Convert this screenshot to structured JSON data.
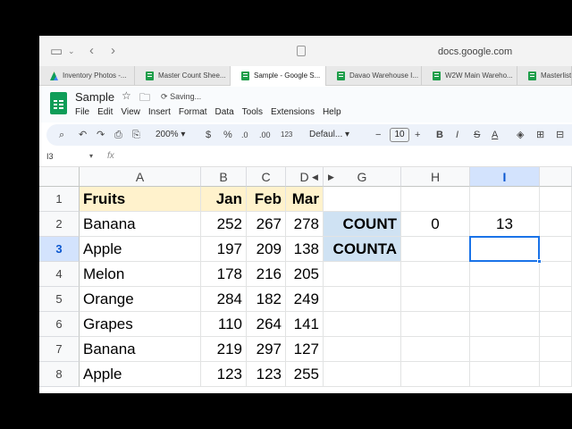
{
  "browser": {
    "url": "docs.google.com",
    "tabs": [
      {
        "label": "Inventory Photos -...",
        "icon": "drive-icon",
        "active": false
      },
      {
        "label": "Master Count Shee...",
        "icon": "sheets-icon",
        "active": false
      },
      {
        "label": "Sample - Google S...",
        "icon": "sheets-icon",
        "active": true
      },
      {
        "label": "Davao Warehouse I...",
        "icon": "sheets-icon",
        "active": false
      },
      {
        "label": "W2W Main Wareho...",
        "icon": "sheets-icon",
        "active": false
      },
      {
        "label": "Masterlist",
        "icon": "sheets-icon",
        "active": false
      }
    ]
  },
  "doc": {
    "title": "Sample",
    "status": "Saving...",
    "menu": [
      "File",
      "Edit",
      "View",
      "Insert",
      "Format",
      "Data",
      "Tools",
      "Extensions",
      "Help"
    ]
  },
  "toolbar": {
    "zoom": "200%",
    "currency": "$",
    "percent": "%",
    "dec_decrease": ".0",
    "dec_increase": ".00",
    "number_format": "123",
    "font": "Defaul...",
    "font_size": "10",
    "minus": "−",
    "plus": "+",
    "bold": "B"
  },
  "formula_bar": {
    "name_box": "I3",
    "fx": "fx",
    "content": ""
  },
  "grid": {
    "columns": [
      "A",
      "B",
      "C",
      "D",
      "G",
      "H",
      "I"
    ],
    "selected_column": "I",
    "rows": [
      {
        "num": "1",
        "A": "Fruits",
        "B": "Jan",
        "C": "Feb",
        "D": "Mar",
        "G": "",
        "H": "",
        "I": ""
      },
      {
        "num": "2",
        "A": "Banana",
        "B": "252",
        "C": "267",
        "D": "278",
        "G": "COUNT",
        "H": "0",
        "I": "13"
      },
      {
        "num": "3",
        "A": "Apple",
        "B": "197",
        "C": "209",
        "D": "138",
        "G": "COUNTA",
        "H": "",
        "I": ""
      },
      {
        "num": "4",
        "A": "Melon",
        "B": "178",
        "C": "216",
        "D": "205",
        "G": "",
        "H": "",
        "I": ""
      },
      {
        "num": "5",
        "A": "Orange",
        "B": "284",
        "C": "182",
        "D": "249",
        "G": "",
        "H": "",
        "I": ""
      },
      {
        "num": "6",
        "A": "Grapes",
        "B": "110",
        "C": "264",
        "D": "141",
        "G": "",
        "H": "",
        "I": ""
      },
      {
        "num": "7",
        "A": "Banana",
        "B": "219",
        "C": "297",
        "D": "127",
        "G": "",
        "H": "",
        "I": ""
      },
      {
        "num": "8",
        "A": "Apple",
        "B": "123",
        "C": "123",
        "D": "255",
        "G": "",
        "H": "",
        "I": ""
      }
    ],
    "selected_row": "3",
    "active_cell": "I3"
  },
  "colors": {
    "header_fill": "#fff2cc",
    "label_fill": "#cfe2f3",
    "accent": "#1a73e8",
    "sheets_green": "#0f9d58"
  }
}
